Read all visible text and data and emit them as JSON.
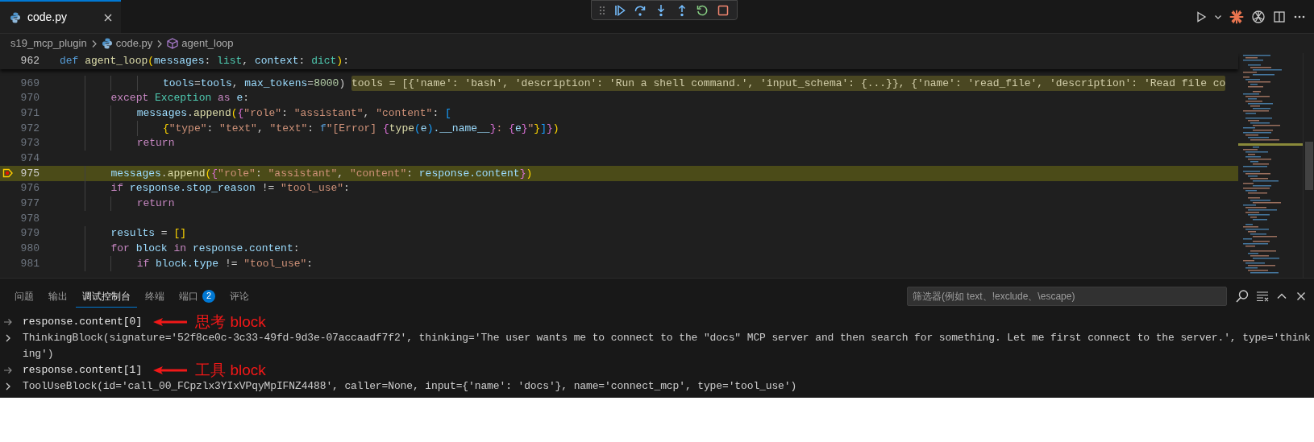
{
  "tabs": [
    {
      "label": "code.py",
      "selected": true
    }
  ],
  "breadcrumb": [
    {
      "kind": "folder",
      "label": "s19_mcp_plugin"
    },
    {
      "kind": "file",
      "label": "code.py"
    },
    {
      "kind": "symbol",
      "label": "agent_loop"
    }
  ],
  "sticky_line": {
    "number": "962",
    "tokens": [
      {
        "kind": "def",
        "text": "def "
      },
      {
        "kind": "fn",
        "text": "agent_loop"
      },
      {
        "kind": "b1",
        "text": "("
      },
      {
        "kind": "var",
        "text": "messages"
      },
      {
        "kind": "p",
        "text": ": "
      },
      {
        "kind": "cls",
        "text": "list"
      },
      {
        "kind": "p",
        "text": ", "
      },
      {
        "kind": "var",
        "text": "context"
      },
      {
        "kind": "p",
        "text": ": "
      },
      {
        "kind": "cls",
        "text": "dict"
      },
      {
        "kind": "b1",
        "text": ")"
      },
      {
        "kind": "p",
        "text": ":"
      }
    ]
  },
  "code_lines": [
    {
      "number": "969",
      "current": false,
      "tokens": [
        {
          "kind": "var",
          "text": "                tools"
        },
        {
          "kind": "p",
          "text": "="
        },
        {
          "kind": "var",
          "text": "tools"
        },
        {
          "kind": "p",
          "text": ", "
        },
        {
          "kind": "var",
          "text": "max_tokens"
        },
        {
          "kind": "p",
          "text": "="
        },
        {
          "kind": "num",
          "text": "8000"
        },
        {
          "kind": "p",
          "text": ") "
        },
        {
          "kind": "hint",
          "text": "tools = [{'name': 'bash', 'description': 'Run a shell command.', 'input_schema': {...}}, {'name': 'read_file', 'description': 'Read file co"
        }
      ]
    },
    {
      "number": "970",
      "current": false,
      "tokens": [
        {
          "kind": "kw",
          "text": "        except "
        },
        {
          "kind": "cls",
          "text": "Exception "
        },
        {
          "kind": "kw",
          "text": "as "
        },
        {
          "kind": "var",
          "text": "e"
        },
        {
          "kind": "p",
          "text": ":"
        }
      ]
    },
    {
      "number": "971",
      "current": false,
      "tokens": [
        {
          "kind": "var",
          "text": "            messages"
        },
        {
          "kind": "p",
          "text": "."
        },
        {
          "kind": "fn",
          "text": "append"
        },
        {
          "kind": "b1",
          "text": "("
        },
        {
          "kind": "b2",
          "text": "{"
        },
        {
          "kind": "str",
          "text": "\"role\""
        },
        {
          "kind": "p",
          "text": ": "
        },
        {
          "kind": "str",
          "text": "\"assistant\""
        },
        {
          "kind": "p",
          "text": ", "
        },
        {
          "kind": "str",
          "text": "\"content\""
        },
        {
          "kind": "p",
          "text": ": "
        },
        {
          "kind": "b3",
          "text": "["
        }
      ]
    },
    {
      "number": "972",
      "current": false,
      "tokens": [
        {
          "kind": "b1",
          "text": "                {"
        },
        {
          "kind": "str",
          "text": "\"type\""
        },
        {
          "kind": "p",
          "text": ": "
        },
        {
          "kind": "str",
          "text": "\"text\""
        },
        {
          "kind": "p",
          "text": ", "
        },
        {
          "kind": "str",
          "text": "\"text\""
        },
        {
          "kind": "p",
          "text": ": "
        },
        {
          "kind": "def",
          "text": "f"
        },
        {
          "kind": "str",
          "text": "\"[Error] "
        },
        {
          "kind": "b2",
          "text": "{"
        },
        {
          "kind": "fn",
          "text": "type"
        },
        {
          "kind": "b3",
          "text": "("
        },
        {
          "kind": "var",
          "text": "e"
        },
        {
          "kind": "b3",
          "text": ")"
        },
        {
          "kind": "var",
          "text": ".__name__"
        },
        {
          "kind": "b2",
          "text": "}"
        },
        {
          "kind": "str",
          "text": ": "
        },
        {
          "kind": "b2",
          "text": "{"
        },
        {
          "kind": "var",
          "text": "e"
        },
        {
          "kind": "b2",
          "text": "}"
        },
        {
          "kind": "str",
          "text": "\""
        },
        {
          "kind": "b1",
          "text": "}"
        },
        {
          "kind": "b3",
          "text": "]"
        },
        {
          "kind": "b2",
          "text": "}"
        },
        {
          "kind": "b1",
          "text": ")"
        }
      ]
    },
    {
      "number": "973",
      "current": false,
      "tokens": [
        {
          "kind": "kw",
          "text": "            return"
        }
      ]
    },
    {
      "number": "974",
      "current": false
    },
    {
      "number": "975",
      "current": true,
      "tokens": [
        {
          "kind": "var",
          "text": "        messages"
        },
        {
          "kind": "p",
          "text": "."
        },
        {
          "kind": "fn",
          "text": "append"
        },
        {
          "kind": "b1",
          "text": "("
        },
        {
          "kind": "b2",
          "text": "{"
        },
        {
          "kind": "str",
          "text": "\"role\""
        },
        {
          "kind": "p",
          "text": ": "
        },
        {
          "kind": "str",
          "text": "\"assistant\""
        },
        {
          "kind": "p",
          "text": ", "
        },
        {
          "kind": "str",
          "text": "\"content\""
        },
        {
          "kind": "p",
          "text": ": "
        },
        {
          "kind": "var",
          "text": "response.content"
        },
        {
          "kind": "b2",
          "text": "}"
        },
        {
          "kind": "b1",
          "text": ")"
        }
      ]
    },
    {
      "number": "976",
      "current": false,
      "tokens": [
        {
          "kind": "kw",
          "text": "        if "
        },
        {
          "kind": "var",
          "text": "response.stop_reason"
        },
        {
          "kind": "p",
          "text": " != "
        },
        {
          "kind": "str",
          "text": "\"tool_use\""
        },
        {
          "kind": "p",
          "text": ":"
        }
      ]
    },
    {
      "number": "977",
      "current": false,
      "tokens": [
        {
          "kind": "kw",
          "text": "            return"
        }
      ]
    },
    {
      "number": "978",
      "current": false
    },
    {
      "number": "979",
      "current": false,
      "tokens": [
        {
          "kind": "var",
          "text": "        results"
        },
        {
          "kind": "p",
          "text": " = "
        },
        {
          "kind": "b1",
          "text": "[]"
        }
      ]
    },
    {
      "number": "980",
      "current": false,
      "tokens": [
        {
          "kind": "kw",
          "text": "        for "
        },
        {
          "kind": "var",
          "text": "block "
        },
        {
          "kind": "kw",
          "text": "in "
        },
        {
          "kind": "var",
          "text": "response.content"
        },
        {
          "kind": "p",
          "text": ":"
        }
      ]
    },
    {
      "number": "981",
      "current": false,
      "tokens": [
        {
          "kind": "kw",
          "text": "            if "
        },
        {
          "kind": "var",
          "text": "block.type"
        },
        {
          "kind": "p",
          "text": " != "
        },
        {
          "kind": "str",
          "text": "\"tool_use\""
        },
        {
          "kind": "p",
          "text": ":"
        }
      ]
    }
  ],
  "panel": {
    "tabs": [
      {
        "label": "问题",
        "selected": false
      },
      {
        "label": "输出",
        "selected": false
      },
      {
        "label": "调试控制台",
        "selected": true
      },
      {
        "label": "终端",
        "selected": false
      },
      {
        "label": "端口",
        "selected": false,
        "badge": "2"
      },
      {
        "label": "评论",
        "selected": false
      }
    ],
    "filter": {
      "placeholder": "筛选器(例如 text、!exclude、\\escape)"
    },
    "console": [
      {
        "kind": "input",
        "text": "response.content[0]",
        "annotation": "思考 block"
      },
      {
        "kind": "output",
        "expanded": false,
        "text": "ThinkingBlock(signature='52f8ce0c-3c33-49fd-9d3e-07accaadf7f2', thinking='The user wants me to connect to the \"docs\" MCP server and then search for something. Let me first connect to the server.', type='thinking')"
      },
      {
        "kind": "input",
        "text": "response.content[1]",
        "annotation": "工具 block"
      },
      {
        "kind": "output",
        "expanded": false,
        "text": "ToolUseBlock(id='call_00_FCpzlx3YIxVPqyMpIFNZ4488', caller=None, input={'name': 'docs'}, name='connect_mcp', type='tool_use')"
      }
    ]
  }
}
